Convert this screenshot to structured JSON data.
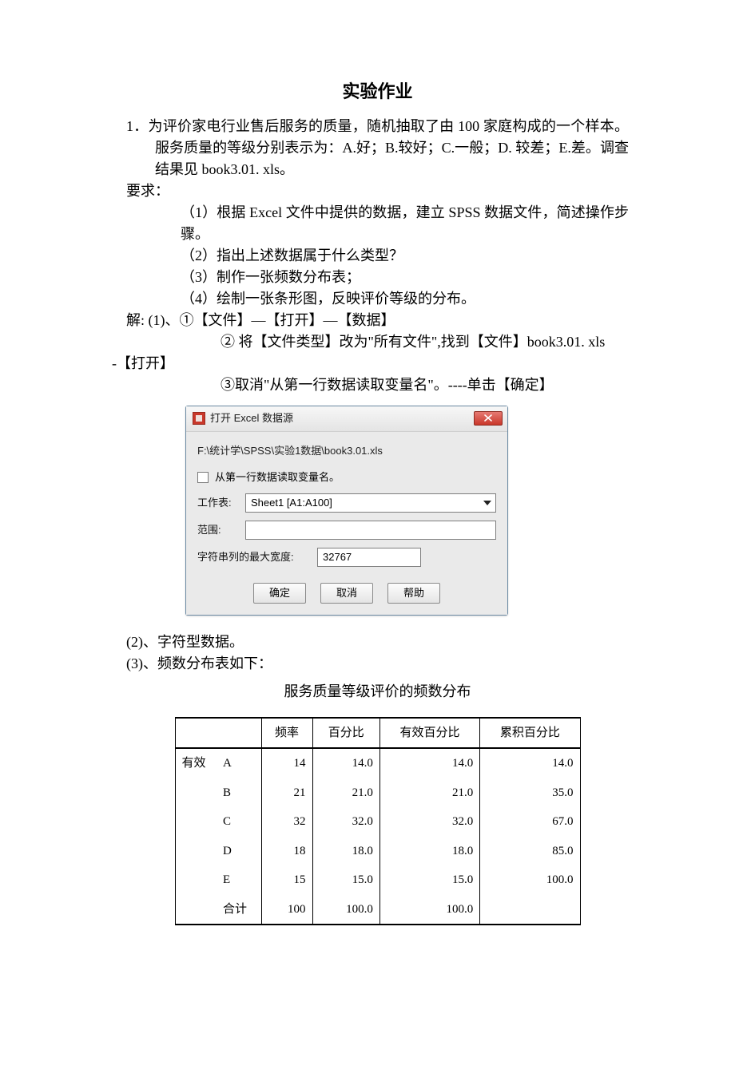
{
  "doc": {
    "title": "实验作业",
    "q1": "1．为评价家电行业售后服务的质量，随机抽取了由 100 家庭构成的一个样本。服务质量的等级分别表示为：A.好；B.较好；C.一般；D. 较差；E.差。调查结果见 book3.01. xls。",
    "req_label": "要求：",
    "req1": "（1）根据 Excel 文件中提供的数据，建立 SPSS 数据文件，简述操作步骤。",
    "req2": "（2）指出上述数据属于什么类型？",
    "req3": "（3）制作一张频数分布表；",
    "req4": "（4）绘制一张条形图，反映评价等级的分布。",
    "ans_label": "解:",
    "ans1": "(1)、①【文件】—【打开】—【数据】",
    "ans1b": "② 将【文件类型】改为\"所有文件\",找到【文件】book3.01. xls",
    "ans1c": "-【打开】",
    "ans1d": "③取消\"从第一行数据读取变量名\"。----单击【确定】",
    "ans2": "(2)、字符型数据。",
    "ans3": "(3)、频数分布表如下：",
    "table_title": "服务质量等级评价的频数分布"
  },
  "dialog": {
    "title": "打开 Excel 数据源",
    "path": "F:\\统计学\\SPSS\\实验1数据\\book3.01.xls",
    "checkbox_label": "从第一行数据读取变量名。",
    "worksheet_label": "工作表:",
    "worksheet_value": "Sheet1 [A1:A100]",
    "range_label": "范围:",
    "range_value": "",
    "maxwidth_label": "字符串列的最大宽度:",
    "maxwidth_value": "32767",
    "btn_ok": "确定",
    "btn_cancel": "取消",
    "btn_help": "帮助"
  },
  "table": {
    "headers": [
      "",
      "",
      "频率",
      "百分比",
      "有效百分比",
      "累积百分比"
    ],
    "group": "有效",
    "rows": [
      {
        "label": "A",
        "freq": "14",
        "pct": "14.0",
        "vpct": "14.0",
        "cpct": "14.0"
      },
      {
        "label": "B",
        "freq": "21",
        "pct": "21.0",
        "vpct": "21.0",
        "cpct": "35.0"
      },
      {
        "label": "C",
        "freq": "32",
        "pct": "32.0",
        "vpct": "32.0",
        "cpct": "67.0"
      },
      {
        "label": "D",
        "freq": "18",
        "pct": "18.0",
        "vpct": "18.0",
        "cpct": "85.0"
      },
      {
        "label": "E",
        "freq": "15",
        "pct": "15.0",
        "vpct": "15.0",
        "cpct": "100.0"
      },
      {
        "label": "合计",
        "freq": "100",
        "pct": "100.0",
        "vpct": "100.0",
        "cpct": ""
      }
    ]
  }
}
